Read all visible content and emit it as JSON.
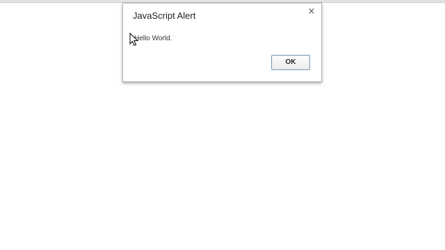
{
  "dialog": {
    "title": "JavaScript Alert",
    "close_glyph": "×",
    "message": "Hello World.",
    "ok_label": "OK"
  },
  "icons": {
    "close": "close-icon",
    "cursor": "mouse-pointer-icon"
  },
  "colors": {
    "background": "#ffffff",
    "dialog_border": "#b9b9b9",
    "button_border": "#7f9db9"
  }
}
